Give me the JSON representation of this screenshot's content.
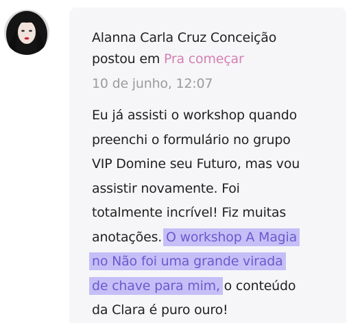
{
  "post": {
    "author": "Alanna Carla Cruz Conceição",
    "posted_in_label": "postou em ",
    "channel": "Pra começar",
    "timestamp": "10 de junho, 12:07",
    "body_lines": [
      "Eu já assisti o workshop quando",
      "preenchi o formulário no grupo",
      "VIP Domine seu Futuro, mas vou",
      "assistir novamente. Foi",
      "totalmente incrível! Fiz muitas"
    ],
    "line6_plain": "anotações. ",
    "line6_highlight": "O workshop A Magia",
    "line7_highlight": "no Não foi uma grande virada",
    "line8_highlight": "de chave para mim,",
    "line8_plain": " o conteúdo",
    "line9_plain": "da Clara é puro ouro!"
  },
  "colors": {
    "link": "#d47fb3",
    "timestamp": "#9b9b9b",
    "highlight_bg": "#c5bff7",
    "highlight_text": "#6a5acd",
    "card_bg": "#f6f6f8"
  }
}
